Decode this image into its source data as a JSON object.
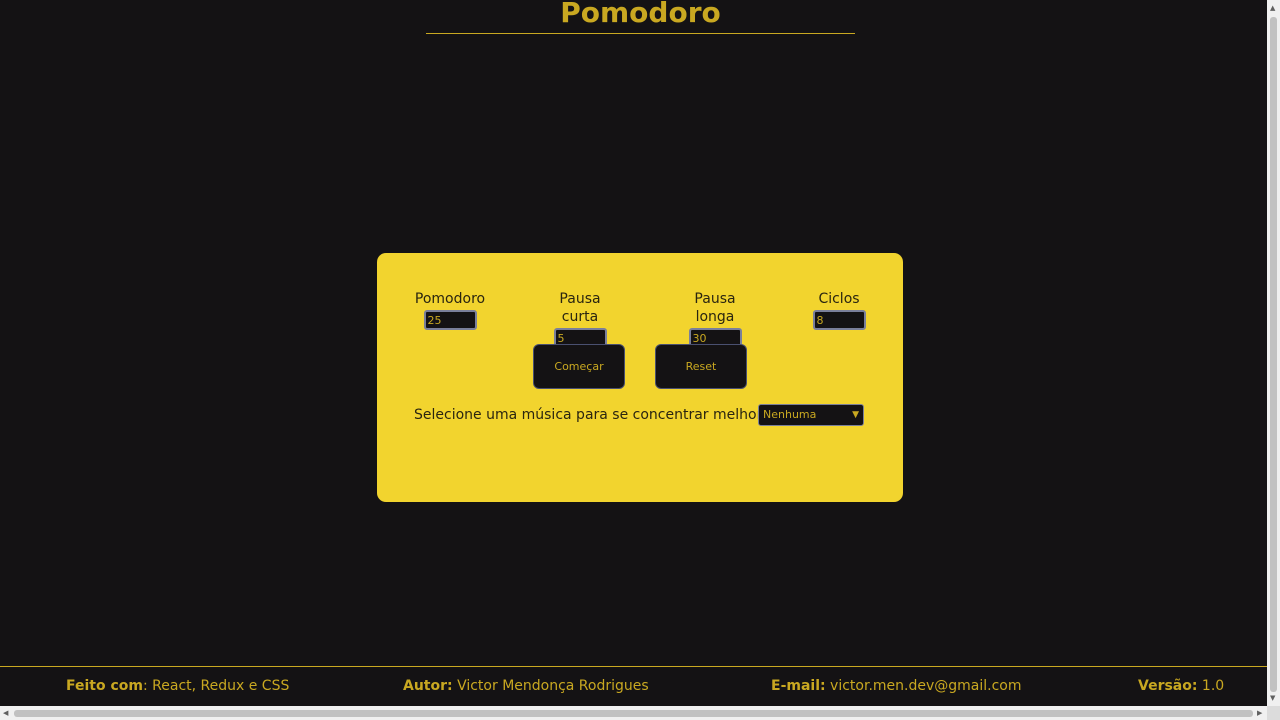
{
  "header": {
    "title": "Pomodoro"
  },
  "settings": {
    "fields": [
      {
        "label": "Pomodoro",
        "value": "25"
      },
      {
        "label": "Pausa curta",
        "value": "5"
      },
      {
        "label": "Pausa longa",
        "value": "30"
      },
      {
        "label": "Ciclos",
        "value": "8"
      }
    ],
    "start_label": "Começar",
    "reset_label": "Reset",
    "music_label": "Selecione uma música para se concentrar melhor:",
    "music_selected": "Nenhuma"
  },
  "footer": {
    "made_with_key": "Feito com",
    "made_with_value": ": React, Redux e CSS",
    "author_key": "Autor:",
    "author_value": " Victor Mendonça Rodrigues",
    "email_key": "E-mail:",
    "email_value": " victor.men.dev@gmail.com",
    "version_key": "Versão:",
    "version_value": " 1.0"
  },
  "colors": {
    "accent": "#c9a821",
    "card": "#f2d42e",
    "background": "#141214"
  }
}
